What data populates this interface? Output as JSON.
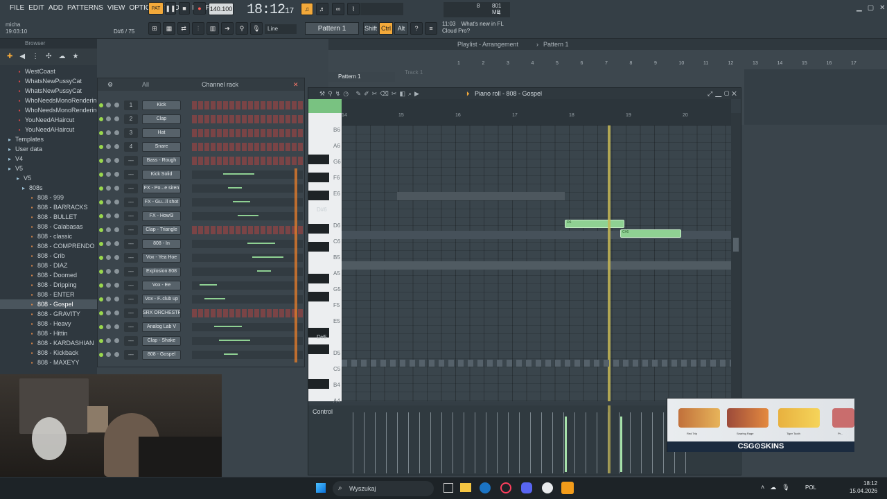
{
  "menu": [
    "FILE",
    "EDIT",
    "ADD",
    "PATTERNS",
    "VIEW",
    "OPTIONS",
    "TOOLS",
    "HELP"
  ],
  "transport": {
    "pat_label": "PAT",
    "tempo": "140.100",
    "time": "18:12",
    "time_small": "17",
    "cpu": "8",
    "mem": "801 MB",
    "poly": "4"
  },
  "hint": {
    "user": "micha",
    "time": "19:03:10",
    "note": "D#6 / 75"
  },
  "toolbar": {
    "pattern": "Pattern 1",
    "snap": "Line",
    "shift": "Shift",
    "ctrl": "Ctrl",
    "alt": "Alt"
  },
  "news": {
    "time": "11:03",
    "line1": "What's new in FL",
    "line2": "Cloud Pro?"
  },
  "browser": {
    "title": "Browser",
    "items": [
      {
        "label": "WestCoast",
        "type": "file"
      },
      {
        "label": "WhatsNewPussyCat",
        "type": "file"
      },
      {
        "label": "WhatsNewPussyCat",
        "type": "file"
      },
      {
        "label": "WhoNeedsMonoRendering",
        "type": "file"
      },
      {
        "label": "WhoNeedsMonoRendering",
        "type": "file"
      },
      {
        "label": "YouNeedAHaircut",
        "type": "file"
      },
      {
        "label": "YouNeedAHaircut",
        "type": "file"
      },
      {
        "label": "Templates",
        "type": "folder"
      },
      {
        "label": "User data",
        "type": "folder"
      },
      {
        "label": "V4",
        "type": "folder"
      },
      {
        "label": "V5",
        "type": "folder"
      },
      {
        "label": "V5",
        "type": "folder"
      },
      {
        "label": "808s",
        "type": "folder"
      },
      {
        "label": "808 - 999",
        "type": "sample"
      },
      {
        "label": "808 - BARRACKS",
        "type": "sample"
      },
      {
        "label": "808 - BULLET",
        "type": "sample"
      },
      {
        "label": "808 - Calabasas",
        "type": "sample"
      },
      {
        "label": "808 - classic",
        "type": "sample"
      },
      {
        "label": "808 - COMPRENDO",
        "type": "sample"
      },
      {
        "label": "808 - Crib",
        "type": "sample"
      },
      {
        "label": "808 - DIAZ",
        "type": "sample"
      },
      {
        "label": "808 - Doomed",
        "type": "sample"
      },
      {
        "label": "808 - Dripping",
        "type": "sample"
      },
      {
        "label": "808 - ENTER",
        "type": "sample"
      },
      {
        "label": "808 - Gospel",
        "type": "sample",
        "selected": true
      },
      {
        "label": "808 - GRAVITY",
        "type": "sample"
      },
      {
        "label": "808 - Heavy",
        "type": "sample"
      },
      {
        "label": "808 - Hittin",
        "type": "sample"
      },
      {
        "label": "808 - KARDASHIAN",
        "type": "sample"
      },
      {
        "label": "808 - Kickback",
        "type": "sample"
      },
      {
        "label": "808 - MAXEYY",
        "type": "sample"
      }
    ]
  },
  "channel_rack": {
    "title": "Channel rack",
    "filter": "All",
    "channels": [
      {
        "num": "1",
        "name": "Kick"
      },
      {
        "num": "2",
        "name": "Clap"
      },
      {
        "num": "3",
        "name": "Hat"
      },
      {
        "num": "4",
        "name": "Snare"
      },
      {
        "num": "---",
        "name": "Bass - Rough"
      },
      {
        "num": "---",
        "name": "Kick Solid"
      },
      {
        "num": "---",
        "name": "FX - Po...e siren"
      },
      {
        "num": "---",
        "name": "FX - Gu...ll shot"
      },
      {
        "num": "---",
        "name": "FX - Howl3"
      },
      {
        "num": "---",
        "name": "Clap - Triangle"
      },
      {
        "num": "---",
        "name": "808 - In"
      },
      {
        "num": "---",
        "name": "Vox - Yea Hoe"
      },
      {
        "num": "---",
        "name": "Explosion 808"
      },
      {
        "num": "---",
        "name": "Vox - Ee"
      },
      {
        "num": "---",
        "name": "Vox - F..club up"
      },
      {
        "num": "---",
        "name": "SRX ORCHESTRA"
      },
      {
        "num": "---",
        "name": "Analog Lab V"
      },
      {
        "num": "---",
        "name": "Clap - Shake"
      },
      {
        "num": "---",
        "name": "808 - Gospel"
      }
    ]
  },
  "playlist": {
    "title": "Playlist - Arrangement",
    "pattern": "Pattern 1",
    "track": "Track 1",
    "pattern_clip": "Pattern 1",
    "bars": [
      "1",
      "2",
      "3",
      "4",
      "5",
      "6",
      "7",
      "8",
      "9",
      "10",
      "11",
      "12",
      "13",
      "14",
      "15",
      "16",
      "17"
    ]
  },
  "piano_roll": {
    "title": "Piano roll - 808 - Gospel",
    "bars": [
      "14",
      "15",
      "16",
      "17",
      "18",
      "19",
      "20"
    ],
    "key_labels": [
      "B6",
      "A6",
      "G6",
      "F6",
      "E6",
      "D#6",
      "D6",
      "C6",
      "B5",
      "A5",
      "G5",
      "F5",
      "E5",
      "D#5",
      "D5",
      "C5",
      "B4",
      "A4"
    ],
    "notes": [
      {
        "label": "D6"
      },
      {
        "label": "C#6"
      }
    ],
    "control": "Control"
  },
  "taskbar": {
    "search": "Wyszukaj",
    "lang": "POL",
    "time": "18:12",
    "date": "15.04.2026"
  },
  "ad": {
    "brand": "CSG⊙SKINS",
    "items": [
      "Red Trip",
      "Searing Rage",
      "Tiger Tooth",
      "Pr..."
    ]
  },
  "colors": {
    "accent": "#ffa21a",
    "note": "#8fd193",
    "playhead": "#e8d46a",
    "led": "#9ad84d"
  }
}
